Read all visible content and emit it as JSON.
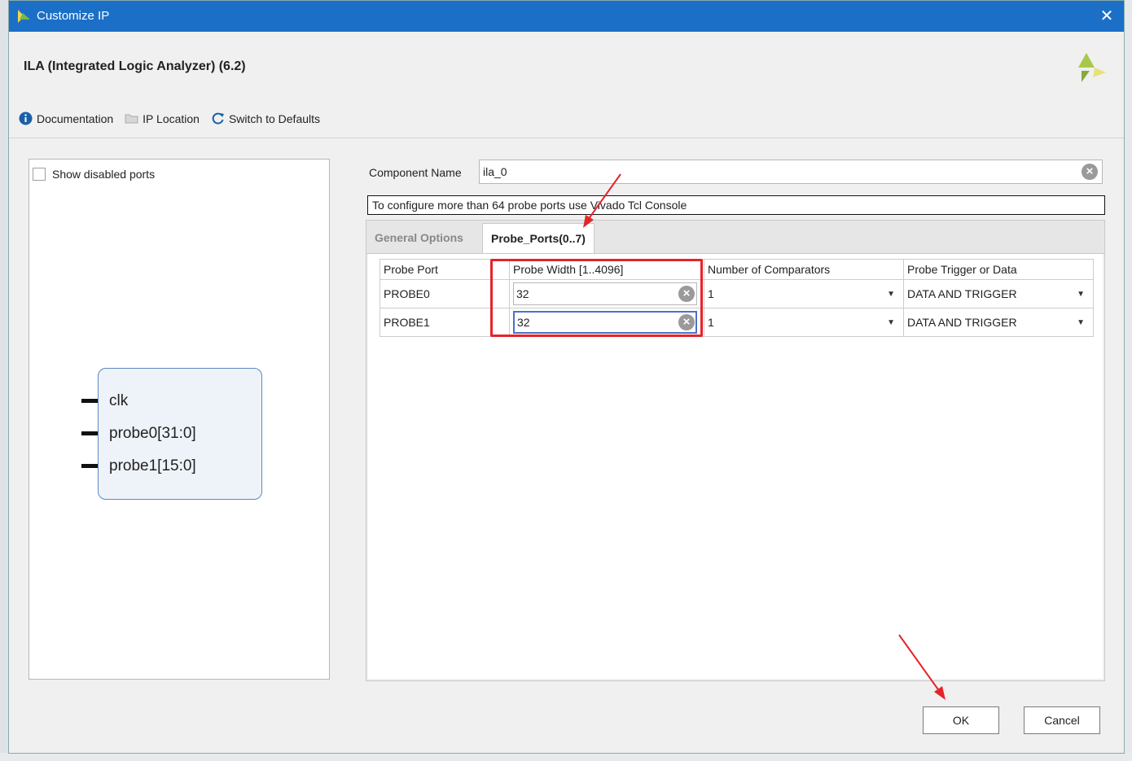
{
  "window": {
    "title": "Customize IP"
  },
  "header": {
    "title": "ILA (Integrated Logic Analyzer) (6.2)"
  },
  "toolbar": {
    "documentation": "Documentation",
    "ip_location": "IP Location",
    "switch_defaults": "Switch to Defaults"
  },
  "left_panel": {
    "show_disabled_ports": "Show disabled ports",
    "show_disabled_checked": false,
    "pins": [
      "clk",
      "probe0[31:0]",
      "probe1[15:0]"
    ]
  },
  "component": {
    "label": "Component Name",
    "value": "ila_0"
  },
  "info_banner": "To configure more than 64 probe ports use Vivado Tcl Console",
  "tabs": [
    {
      "label": "General Options",
      "active": false
    },
    {
      "label": "Probe_Ports(0..7)",
      "active": true
    }
  ],
  "probe_table": {
    "columns": [
      "Probe Port",
      "Probe Width [1..4096]",
      "Number of Comparators",
      "Probe Trigger or Data"
    ],
    "rows": [
      {
        "port": "PROBE0",
        "width": "32",
        "comparators": "1",
        "trigger": "DATA AND TRIGGER"
      },
      {
        "port": "PROBE1",
        "width": "32",
        "comparators": "1",
        "trigger": "DATA AND TRIGGER"
      }
    ]
  },
  "buttons": {
    "ok": "OK",
    "cancel": "Cancel"
  },
  "colors": {
    "titlebar": "#1b6fc7",
    "annotation_red": "#e4242b",
    "focus_border": "#4a72c8"
  },
  "icons": {
    "title": "vivado-logo-icon",
    "documentation": "info-icon",
    "ip_location": "folder-icon",
    "switch": "refresh-icon",
    "clear": "clear-icon",
    "dropdown": "dropdown-arrow-icon"
  }
}
